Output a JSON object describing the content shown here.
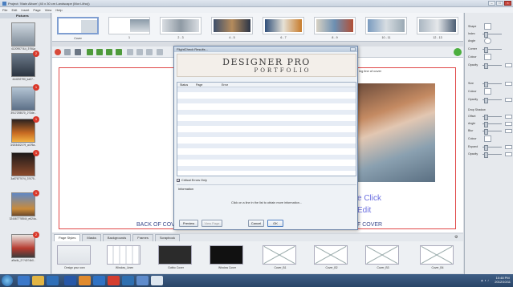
{
  "window": {
    "title": "Project: 'Main Album' (40 x 30 cm Landscape (Mor Litho))"
  },
  "menu": [
    "File",
    "Edit",
    "Insert",
    "Page",
    "View",
    "Help"
  ],
  "pictures_panel": {
    "header": "Pictures",
    "items": [
      {
        "caption": "4120957?&4_3?5&a",
        "badge": ""
      },
      {
        "caption": "444202?90_ka0?..",
        "badge": "2"
      },
      {
        "caption": "3917293570_2?3de..",
        "badge": "1"
      },
      {
        "caption": "3/2034021?9_a4?5a..",
        "badge": "1"
      },
      {
        "caption": "3a5767?0?4_3?075..",
        "badge": "1"
      },
      {
        "caption": "3244677?8544_e624a..",
        "badge": "1"
      },
      {
        "caption": "a9a4b_2??40?4b0..",
        "badge": "2"
      }
    ]
  },
  "page_strip": {
    "spreads": [
      {
        "label": "Cover"
      },
      {
        "label": "1"
      },
      {
        "label": "2 - 3"
      },
      {
        "label": "4 - 5"
      },
      {
        "label": "6 - 7"
      },
      {
        "label": "8 - 9"
      },
      {
        "label": "10 - 11"
      },
      {
        "label": "12 - 13"
      }
    ]
  },
  "canvas": {
    "back_cover": "BACK OF COVER",
    "front_cover": "F COVER",
    "spine_note": "ing line of cover",
    "click_lines": [
      "e Click",
      "Edit"
    ]
  },
  "bottom_tabs": [
    "Page Styles",
    "Masks",
    "Backgrounds",
    "Frames",
    "Scrapbook"
  ],
  "templates": [
    "Design your own",
    "Window_Linen",
    "Gothic Cover",
    "Window Cover",
    "Cover_B1",
    "Cover_B2",
    "Cover_B3",
    "Cover_B4"
  ],
  "right_panel": {
    "labels": [
      "Shape",
      "Index",
      "Angle",
      "Corner",
      "Colour",
      "Opacity",
      "Size",
      "Colour",
      "Opacity",
      "Drop Shadow",
      "Offset",
      "Angle",
      "Blur",
      "Colour",
      "Expand",
      "Opacity"
    ]
  },
  "dialog": {
    "title": "FlightCheck Results...",
    "logo_line1": "DESIGNER PRO",
    "logo_line2": "PORTFOLIO",
    "columns": [
      "Status",
      "Page",
      "Error"
    ],
    "critical_label": "Critical Errors Only",
    "info_label": "Information",
    "info_text": "Click on a line in the list to obtain more information...",
    "buttons": {
      "preview": "Preview",
      "view_page": "View Page",
      "cancel": "Cancel",
      "ok": "OK"
    }
  },
  "taskbar": {
    "time": "10:48 PM",
    "date": "2012/10/11"
  }
}
